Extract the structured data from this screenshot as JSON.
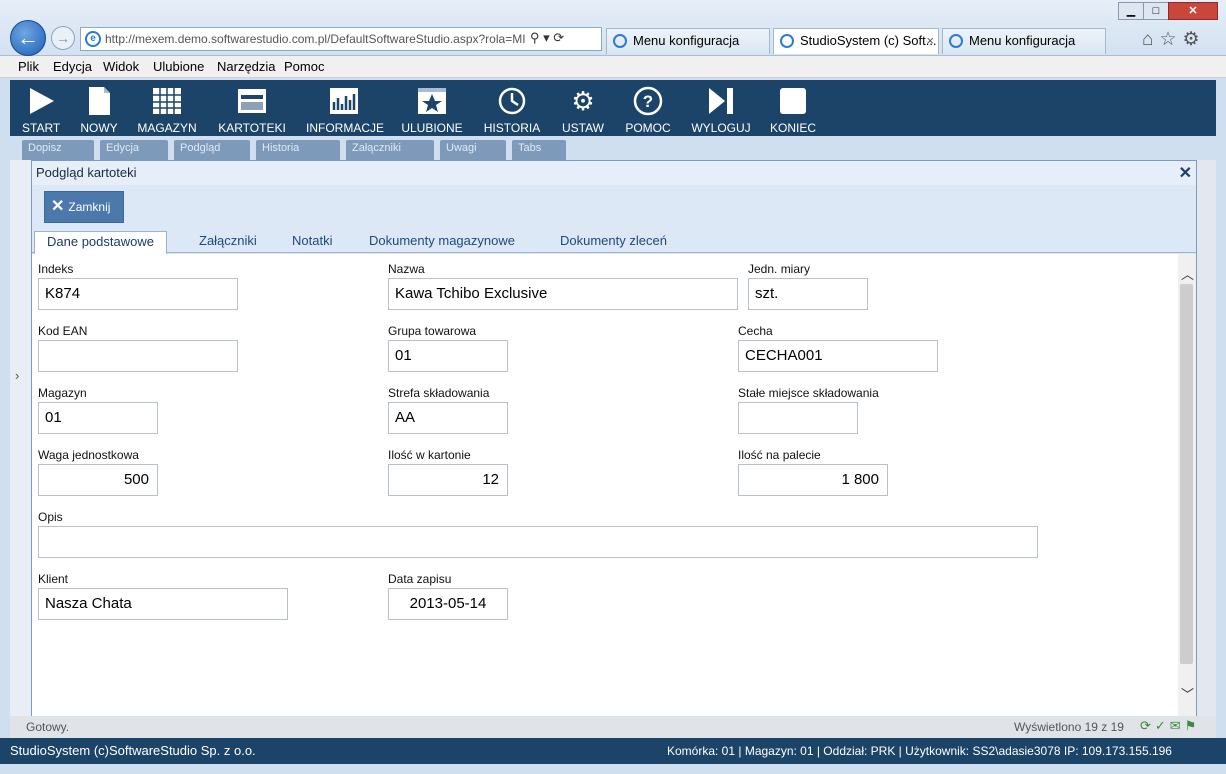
{
  "browser": {
    "url": "http://mexem.demo.softwarestudio.com.pl/DefaultSoftwareStudio.aspx?rola=MI",
    "tabs": [
      "Menu konfiguracja",
      "StudioSystem (c) Soft...",
      "Menu konfiguracja"
    ],
    "menu": [
      "Plik",
      "Edycja",
      "Widok",
      "Ulubione",
      "Narzędzia",
      "Pomoc"
    ]
  },
  "toolbar": [
    "START",
    "NOWY",
    "MAGAZYN",
    "KARTOTEKI",
    "INFORMACJE",
    "ULUBIONE",
    "HISTORIA",
    "USTAW",
    "POMOC",
    "WYLOGUJ",
    "KONIEC"
  ],
  "subtoolbar": [
    "Dopisz",
    "Edycja",
    "Podgląd",
    "Historia",
    "Załączniki",
    "Uwagi",
    "Tabs"
  ],
  "modal": {
    "title": "Podgląd kartoteki",
    "close_label": "Zamknij",
    "tabs": [
      "Dane podstawowe",
      "Załączniki",
      "Notatki",
      "Dokumenty magazynowe",
      "Dokumenty zleceń"
    ],
    "fields": {
      "indeks": {
        "label": "Indeks",
        "value": "K874"
      },
      "nazwa": {
        "label": "Nazwa",
        "value": "Kawa Tchibo Exclusive"
      },
      "jedn": {
        "label": "Jedn. miary",
        "value": "szt."
      },
      "ean": {
        "label": "Kod EAN",
        "value": ""
      },
      "grupa": {
        "label": "Grupa towarowa",
        "value": "01"
      },
      "cecha": {
        "label": "Cecha",
        "value": "CECHA001"
      },
      "magazyn": {
        "label": "Magazyn",
        "value": "01"
      },
      "strefa": {
        "label": "Strefa składowania",
        "value": "AA"
      },
      "miejsce": {
        "label": "Stałe miejsce składowania",
        "value": ""
      },
      "waga": {
        "label": "Waga jednostkowa",
        "value": "500"
      },
      "karton": {
        "label": "Ilość w kartonie",
        "value": "12"
      },
      "paleta": {
        "label": "Ilość na palecie",
        "value": "1 800"
      },
      "opis": {
        "label": "Opis",
        "value": ""
      },
      "klient": {
        "label": "Klient",
        "value": "Nasza Chata"
      },
      "data": {
        "label": "Data zapisu",
        "value": "2013-05-14"
      }
    }
  },
  "status": {
    "left": "Gotowy.",
    "right": "Wyświetlono 19 z 19"
  },
  "footer": {
    "left": "StudioSystem (c)SoftwareStudio Sp. z o.o.",
    "right": "Komórka: 01 | Magazyn: 01 | Oddział: PRK | Użytkownik: SS2\\adasie3078 IP: 109.173.155.196"
  }
}
